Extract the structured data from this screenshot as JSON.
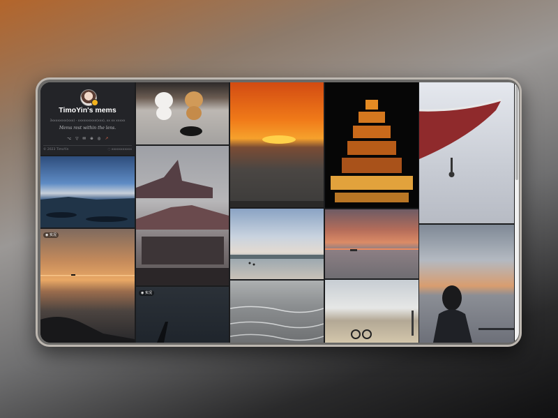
{
  "profile": {
    "name": "TimoYin's mems",
    "stats": "3xxxxxxxx(xxx) - xxxxxxxxxx(xxx), xx xx xxxxx",
    "motto": "Mems rest within the lens.",
    "social_icons": [
      "github-icon",
      "vercel-icon",
      "link-icon",
      "at-icon",
      "globe-icon",
      "rss-icon"
    ],
    "social_glyphs": [
      "⌥",
      "▽",
      "✉",
      "⊕",
      "◎",
      "↗"
    ],
    "copyright": "© 2023 TimoYin",
    "powered_by": "◌ xxxxxxxxxxx"
  },
  "badges": {
    "live": "◉ 实况"
  },
  "colors": {
    "card_bg": "#232428",
    "accent": "#f2b21d"
  }
}
